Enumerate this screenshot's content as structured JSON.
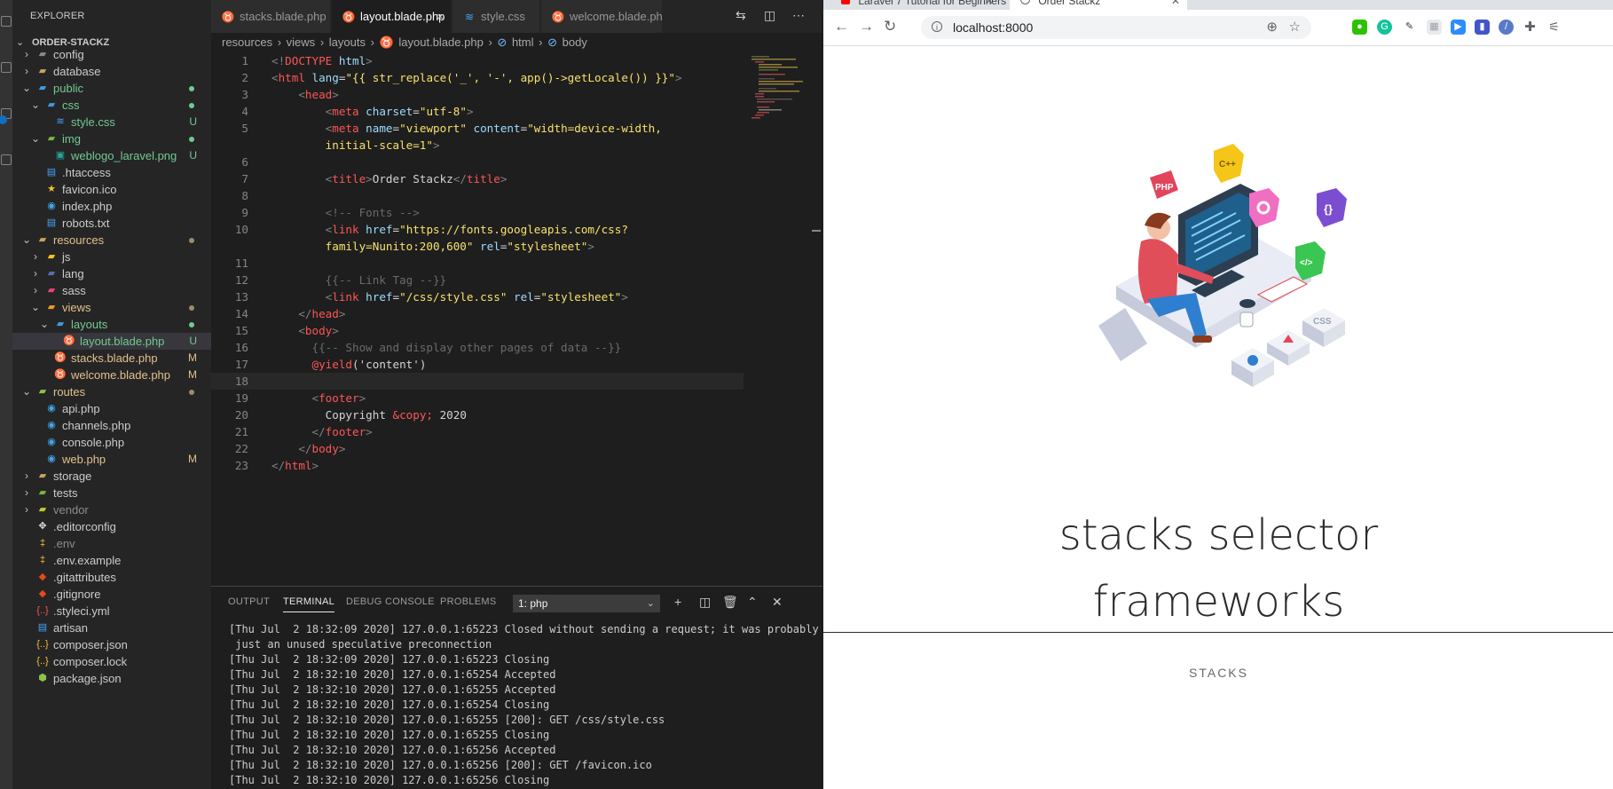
{
  "explorer": {
    "title": "EXPLORER",
    "section": "ORDER-STACKZ",
    "items": [
      {
        "label": "config",
        "indent": 1,
        "kind": "folder",
        "open": false,
        "color": "#cccccc",
        "icon_color": "#8a8a8a",
        "status": "",
        "dot": ""
      },
      {
        "label": "database",
        "indent": 1,
        "kind": "folder",
        "open": false,
        "color": "#cccccc",
        "icon_color": "#c9a35b",
        "status": "",
        "dot": ""
      },
      {
        "label": "public",
        "indent": 1,
        "kind": "folder",
        "open": true,
        "color": "#73c991",
        "icon_color": "#3e9adc",
        "status": "",
        "dot": "#73c991"
      },
      {
        "label": "css",
        "indent": 2,
        "kind": "folder",
        "open": true,
        "color": "#73c991",
        "icon_color": "#3e9adc",
        "status": "",
        "dot": "#73c991"
      },
      {
        "label": "style.css",
        "indent": 3,
        "kind": "file",
        "color": "#73c991",
        "icon": "≋",
        "icon_color": "#42a5f5",
        "status": "U",
        "status_color": "#73c991",
        "dot": ""
      },
      {
        "label": "img",
        "indent": 2,
        "kind": "folder",
        "open": true,
        "color": "#73c991",
        "icon_color": "#7cb342",
        "status": "",
        "dot": "#73c991"
      },
      {
        "label": "weblogo_laravel.png",
        "indent": 3,
        "kind": "file",
        "color": "#73c991",
        "icon": "▣",
        "icon_color": "#26a69a",
        "status": "U",
        "status_color": "#73c991",
        "dot": ""
      },
      {
        "label": ".htaccess",
        "indent": 2,
        "kind": "file",
        "color": "#cccccc",
        "icon": "▤",
        "icon_color": "#42a5f5",
        "status": "",
        "dot": ""
      },
      {
        "label": "favicon.ico",
        "indent": 2,
        "kind": "file",
        "color": "#cccccc",
        "icon": "★",
        "icon_color": "#fbc02d",
        "status": "",
        "dot": ""
      },
      {
        "label": "index.php",
        "indent": 2,
        "kind": "file",
        "color": "#cccccc",
        "icon": "◉",
        "icon_color": "#41a5ee",
        "status": "",
        "dot": ""
      },
      {
        "label": "robots.txt",
        "indent": 2,
        "kind": "file",
        "color": "#cccccc",
        "icon": "▤",
        "icon_color": "#42a5f5",
        "status": "",
        "dot": ""
      },
      {
        "label": "resources",
        "indent": 1,
        "kind": "folder",
        "open": true,
        "color": "#e2c08d",
        "icon_color": "#c9a35b",
        "status": "",
        "dot": "#9e8a6a"
      },
      {
        "label": "js",
        "indent": 2,
        "kind": "folder",
        "open": false,
        "color": "#cccccc",
        "icon_color": "#f5c518",
        "status": "",
        "dot": ""
      },
      {
        "label": "lang",
        "indent": 2,
        "kind": "folder",
        "open": false,
        "color": "#cccccc",
        "icon_color": "#5c6bc0",
        "status": "",
        "dot": ""
      },
      {
        "label": "sass",
        "indent": 2,
        "kind": "folder",
        "open": false,
        "color": "#cccccc",
        "icon_color": "#ec407a",
        "status": "",
        "dot": ""
      },
      {
        "label": "views",
        "indent": 2,
        "kind": "folder",
        "open": true,
        "color": "#e2c08d",
        "icon_color": "#ef9a29",
        "status": "",
        "dot": "#9e8a6a"
      },
      {
        "label": "layouts",
        "indent": 3,
        "kind": "folder",
        "open": true,
        "color": "#73c991",
        "icon_color": "#3e9adc",
        "status": "",
        "dot": "#73c991"
      },
      {
        "label": "layout.blade.php",
        "indent": 4,
        "kind": "file",
        "color": "#73c991",
        "icon": "♉",
        "icon_color": "#f4645f",
        "status": "U",
        "status_color": "#73c991",
        "dot": "",
        "selected": true
      },
      {
        "label": "stacks.blade.php",
        "indent": 3,
        "kind": "file",
        "color": "#e2c08d",
        "icon": "♉",
        "icon_color": "#f4645f",
        "status": "M",
        "status_color": "#e2c08d",
        "dot": ""
      },
      {
        "label": "welcome.blade.php",
        "indent": 3,
        "kind": "file",
        "color": "#e2c08d",
        "icon": "♉",
        "icon_color": "#f4645f",
        "status": "M",
        "status_color": "#e2c08d",
        "dot": ""
      },
      {
        "label": "routes",
        "indent": 1,
        "kind": "folder",
        "open": true,
        "color": "#e2c08d",
        "icon_color": "#8bc34a",
        "status": "",
        "dot": "#9e8a6a"
      },
      {
        "label": "api.php",
        "indent": 2,
        "kind": "file",
        "color": "#cccccc",
        "icon": "◉",
        "icon_color": "#41a5ee",
        "status": "",
        "dot": ""
      },
      {
        "label": "channels.php",
        "indent": 2,
        "kind": "file",
        "color": "#cccccc",
        "icon": "◉",
        "icon_color": "#41a5ee",
        "status": "",
        "dot": ""
      },
      {
        "label": "console.php",
        "indent": 2,
        "kind": "file",
        "color": "#cccccc",
        "icon": "◉",
        "icon_color": "#41a5ee",
        "status": "",
        "dot": ""
      },
      {
        "label": "web.php",
        "indent": 2,
        "kind": "file",
        "color": "#e2c08d",
        "icon": "◉",
        "icon_color": "#41a5ee",
        "status": "M",
        "status_color": "#e2c08d",
        "dot": ""
      },
      {
        "label": "storage",
        "indent": 1,
        "kind": "folder",
        "open": false,
        "color": "#cccccc",
        "icon_color": "#c9a35b",
        "status": "",
        "dot": ""
      },
      {
        "label": "tests",
        "indent": 1,
        "kind": "folder",
        "open": false,
        "color": "#cccccc",
        "icon_color": "#7cb342",
        "status": "",
        "dot": ""
      },
      {
        "label": "vendor",
        "indent": 1,
        "kind": "folder",
        "open": false,
        "color": "#8c8c8c",
        "icon_color": "#c0ca33",
        "status": "",
        "dot": ""
      },
      {
        "label": ".editorconfig",
        "indent": 1,
        "kind": "file",
        "color": "#cccccc",
        "icon": "✥",
        "icon_color": "#e0e0e0",
        "status": "",
        "dot": ""
      },
      {
        "label": ".env",
        "indent": 1,
        "kind": "file",
        "color": "#8c8c8c",
        "icon": "‡",
        "icon_color": "#fbc02d",
        "status": "",
        "dot": ""
      },
      {
        "label": ".env.example",
        "indent": 1,
        "kind": "file",
        "color": "#cccccc",
        "icon": "‡",
        "icon_color": "#fbc02d",
        "status": "",
        "dot": ""
      },
      {
        "label": ".gitattributes",
        "indent": 1,
        "kind": "file",
        "color": "#cccccc",
        "icon": "◆",
        "icon_color": "#e64a19",
        "status": "",
        "dot": ""
      },
      {
        "label": ".gitignore",
        "indent": 1,
        "kind": "file",
        "color": "#cccccc",
        "icon": "◆",
        "icon_color": "#e64a19",
        "status": "",
        "dot": ""
      },
      {
        "label": ".styleci.yml",
        "indent": 1,
        "kind": "file",
        "color": "#cccccc",
        "icon": "{..}",
        "icon_color": "#ff5252",
        "status": "",
        "dot": ""
      },
      {
        "label": "artisan",
        "indent": 1,
        "kind": "file",
        "color": "#cccccc",
        "icon": "▤",
        "icon_color": "#42a5f5",
        "status": "",
        "dot": ""
      },
      {
        "label": "composer.json",
        "indent": 1,
        "kind": "file",
        "color": "#cccccc",
        "icon": "{..}",
        "icon_color": "#fbc02d",
        "status": "",
        "dot": ""
      },
      {
        "label": "composer.lock",
        "indent": 1,
        "kind": "file",
        "color": "#cccccc",
        "icon": "{..}",
        "icon_color": "#fbc02d",
        "status": "",
        "dot": ""
      },
      {
        "label": "package.json",
        "indent": 1,
        "kind": "file",
        "color": "#cccccc",
        "icon": "⬢",
        "icon_color": "#8bc34a",
        "status": "",
        "dot": ""
      }
    ]
  },
  "tabs": [
    {
      "label": "stacks.blade.php",
      "icon": "♉",
      "icon_color": "#f4645f",
      "active": false,
      "close": ""
    },
    {
      "label": "layout.blade.php",
      "icon": "♉",
      "icon_color": "#f4645f",
      "active": true,
      "close": "×"
    },
    {
      "label": "style.css",
      "icon": "≋",
      "icon_color": "#42a5f5",
      "active": false,
      "close": ""
    },
    {
      "label": "welcome.blade.php",
      "icon": "♉",
      "icon_color": "#f4645f",
      "active": false,
      "close": ""
    }
  ],
  "breadcrumb": [
    "resources",
    "views",
    "layouts",
    "layout.blade.php",
    "html",
    "body"
  ],
  "code": {
    "current_line": 18,
    "lines": [
      {
        "n": "1",
        "segs": [
          [
            "<!",
            "#808080"
          ],
          [
            "DOCTYPE",
            "#ff5555"
          ],
          [
            " html",
            "#9cdcfe"
          ],
          [
            ">",
            "#808080"
          ]
        ]
      },
      {
        "n": "2",
        "segs": [
          [
            "<",
            "#808080"
          ],
          [
            "html",
            "#ff5555"
          ],
          [
            " lang",
            "#9cdcfe"
          ],
          [
            "=",
            "#d4d4d4"
          ],
          [
            "\"{{ str_replace('_', '-', app()->getLocale()) }}\"",
            "#f7e26b"
          ],
          [
            ">",
            "#808080"
          ]
        ]
      },
      {
        "n": "3",
        "segs": [
          [
            "    <",
            "#808080"
          ],
          [
            "head",
            "#ff5555"
          ],
          [
            ">",
            "#808080"
          ]
        ]
      },
      {
        "n": "4",
        "segs": [
          [
            "        <",
            "#808080"
          ],
          [
            "meta",
            "#ff5555"
          ],
          [
            " charset",
            "#9cdcfe"
          ],
          [
            "=",
            "#d4d4d4"
          ],
          [
            "\"utf-8\"",
            "#f7e26b"
          ],
          [
            ">",
            "#808080"
          ]
        ]
      },
      {
        "n": "5",
        "segs": [
          [
            "        <",
            "#808080"
          ],
          [
            "meta",
            "#ff5555"
          ],
          [
            " name",
            "#9cdcfe"
          ],
          [
            "=",
            "#d4d4d4"
          ],
          [
            "\"viewport\"",
            "#f7e26b"
          ],
          [
            " content",
            "#9cdcfe"
          ],
          [
            "=",
            "#d4d4d4"
          ],
          [
            "\"width=device-width,",
            "#f7e26b"
          ]
        ]
      },
      {
        "n": "",
        "segs": [
          [
            "        initial-scale=1\"",
            "#f7e26b"
          ],
          [
            ">",
            "#808080"
          ]
        ]
      },
      {
        "n": "6",
        "segs": []
      },
      {
        "n": "7",
        "segs": [
          [
            "        <",
            "#808080"
          ],
          [
            "title",
            "#ff5555"
          ],
          [
            ">",
            "#808080"
          ],
          [
            "Order Stackz",
            "#d4d4d4"
          ],
          [
            "</",
            "#808080"
          ],
          [
            "title",
            "#ff5555"
          ],
          [
            ">",
            "#808080"
          ]
        ]
      },
      {
        "n": "8",
        "segs": []
      },
      {
        "n": "9",
        "segs": [
          [
            "        <!-- Fonts -->",
            "#6a6a6a"
          ]
        ]
      },
      {
        "n": "10",
        "segs": [
          [
            "        <",
            "#808080"
          ],
          [
            "link",
            "#ff5555"
          ],
          [
            " href",
            "#9cdcfe"
          ],
          [
            "=",
            "#d4d4d4"
          ],
          [
            "\"https://fonts.googleapis.com/css?",
            "#f7e26b"
          ]
        ]
      },
      {
        "n": "",
        "segs": [
          [
            "        family=Nunito:200,600\"",
            "#f7e26b"
          ],
          [
            " rel",
            "#9cdcfe"
          ],
          [
            "=",
            "#d4d4d4"
          ],
          [
            "\"stylesheet\"",
            "#f7e26b"
          ],
          [
            ">",
            "#808080"
          ]
        ]
      },
      {
        "n": "11",
        "segs": []
      },
      {
        "n": "12",
        "segs": [
          [
            "        {{-- Link Tag --}}",
            "#6a6a6a"
          ]
        ]
      },
      {
        "n": "13",
        "segs": [
          [
            "        <",
            "#808080"
          ],
          [
            "link",
            "#ff5555"
          ],
          [
            " href",
            "#9cdcfe"
          ],
          [
            "=",
            "#d4d4d4"
          ],
          [
            "\"/css/style.css\"",
            "#f7e26b"
          ],
          [
            " rel",
            "#9cdcfe"
          ],
          [
            "=",
            "#d4d4d4"
          ],
          [
            "\"stylesheet\"",
            "#f7e26b"
          ],
          [
            ">",
            "#808080"
          ]
        ]
      },
      {
        "n": "14",
        "segs": [
          [
            "    </",
            "#808080"
          ],
          [
            "head",
            "#ff5555"
          ],
          [
            ">",
            "#808080"
          ]
        ]
      },
      {
        "n": "15",
        "segs": [
          [
            "    <",
            "#808080"
          ],
          [
            "body",
            "#ff5555"
          ],
          [
            ">",
            "#808080"
          ]
        ]
      },
      {
        "n": "16",
        "segs": [
          [
            "      {{-- Show and display other pages of data --}}",
            "#6a6a6a"
          ]
        ]
      },
      {
        "n": "17",
        "segs": [
          [
            "      @yield",
            "#ff5555"
          ],
          [
            "('content')",
            "#d4d4d4"
          ]
        ]
      },
      {
        "n": "18",
        "segs": []
      },
      {
        "n": "19",
        "segs": [
          [
            "      <",
            "#808080"
          ],
          [
            "footer",
            "#ff5555"
          ],
          [
            ">",
            "#808080"
          ]
        ]
      },
      {
        "n": "20",
        "segs": [
          [
            "        Copyright ",
            "#d4d4d4"
          ],
          [
            "&copy;",
            "#ff5555"
          ],
          [
            " 2020",
            "#d4d4d4"
          ]
        ]
      },
      {
        "n": "21",
        "segs": [
          [
            "      </",
            "#808080"
          ],
          [
            "footer",
            "#ff5555"
          ],
          [
            ">",
            "#808080"
          ]
        ]
      },
      {
        "n": "22",
        "segs": [
          [
            "    </",
            "#808080"
          ],
          [
            "body",
            "#ff5555"
          ],
          [
            ">",
            "#808080"
          ]
        ]
      },
      {
        "n": "23",
        "segs": [
          [
            "</",
            "#808080"
          ],
          [
            "html",
            "#ff5555"
          ],
          [
            ">",
            "#808080"
          ]
        ]
      }
    ]
  },
  "panel": {
    "tabs": [
      "OUTPUT",
      "TERMINAL",
      "DEBUG CONSOLE",
      "PROBLEMS"
    ],
    "active_tab": "TERMINAL",
    "terminal_select": "1: php",
    "terminal_lines": [
      "[Thu Jul  2 18:32:09 2020] 127.0.0.1:65223 Closed without sending a request; it was probably",
      " just an unused speculative preconnection",
      "[Thu Jul  2 18:32:09 2020] 127.0.0.1:65223 Closing",
      "[Thu Jul  2 18:32:10 2020] 127.0.0.1:65254 Accepted",
      "[Thu Jul  2 18:32:10 2020] 127.0.0.1:65255 Accepted",
      "[Thu Jul  2 18:32:10 2020] 127.0.0.1:65254 Closing",
      "[Thu Jul  2 18:32:10 2020] 127.0.0.1:65255 [200]: GET /css/style.css",
      "[Thu Jul  2 18:32:10 2020] 127.0.0.1:65255 Closing",
      "[Thu Jul  2 18:32:10 2020] 127.0.0.1:65256 Accepted",
      "[Thu Jul  2 18:32:10 2020] 127.0.0.1:65256 [200]: GET /favicon.ico",
      "[Thu Jul  2 18:32:10 2020] 127.0.0.1:65256 Closing"
    ]
  },
  "browser": {
    "tabs": [
      {
        "label": "Laravel 7 Tutorial for Beginners",
        "active": false
      },
      {
        "label": "Order Stackz",
        "active": true
      }
    ],
    "url": "localhost:8000",
    "heading_line1": "stacks selector",
    "heading_line2": "frameworks",
    "stacks_label": "STACKS",
    "illustration": {
      "cubes": [
        "PHP",
        "C++",
        "{}",
        "</>",
        "CSS"
      ]
    }
  }
}
